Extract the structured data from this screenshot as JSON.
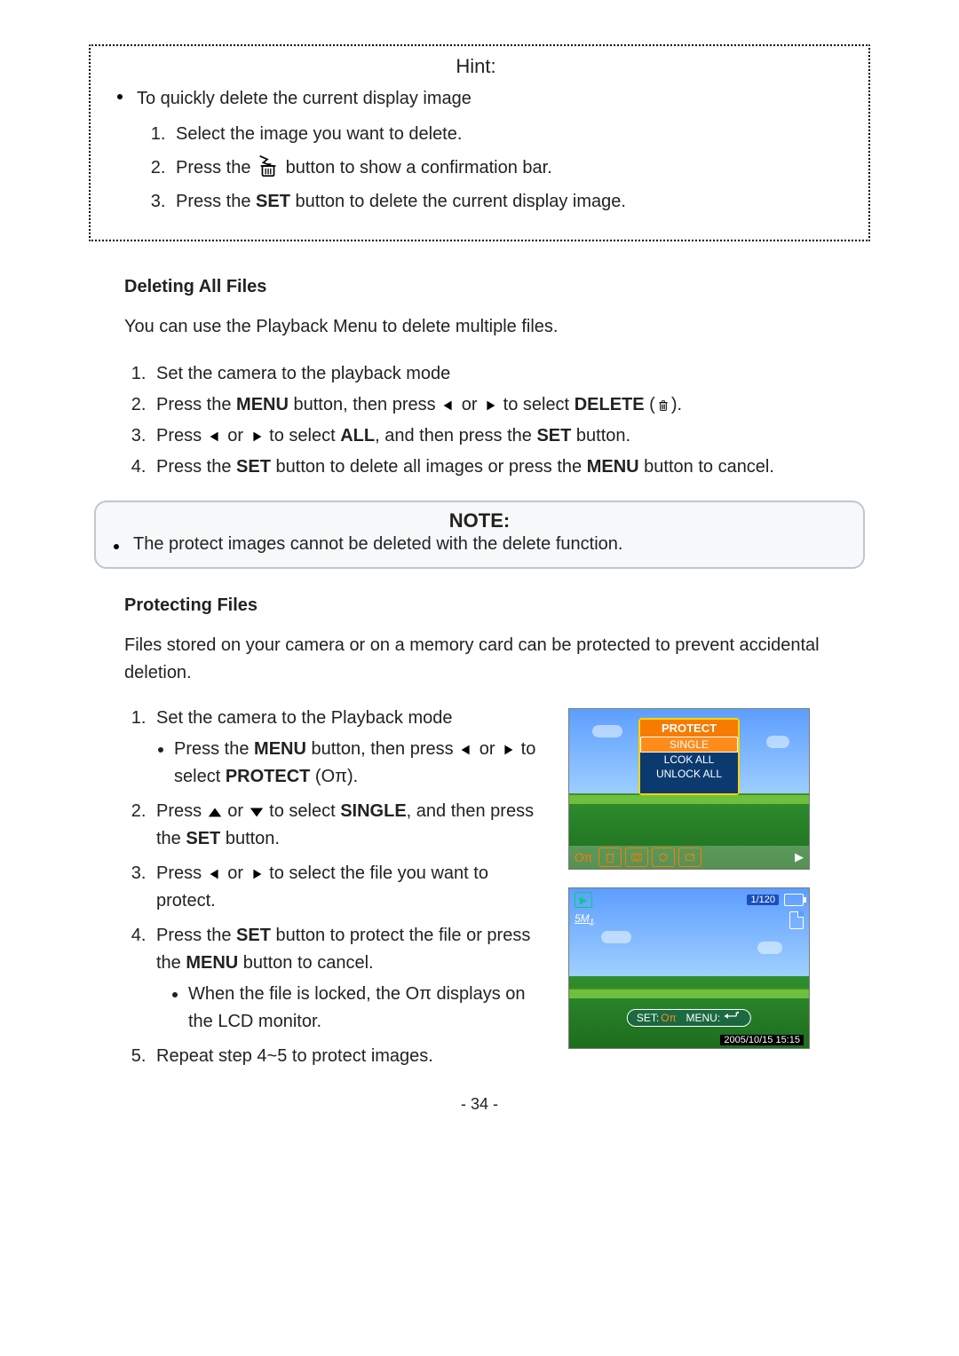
{
  "hint": {
    "title": "Hint:",
    "bullet": "To quickly delete the current display image",
    "steps": [
      "Select the image you want to delete.",
      "Press the ICON_FLASHTRASH button to show a confirmation bar.",
      "Press the SET button to delete the current display image."
    ]
  },
  "section_delete_all": {
    "heading": "Deleting All Files",
    "intro": "You can use the Playback Menu to delete multiple files.",
    "steps": [
      "Set the camera to the playback mode",
      "Press the MENU button, then press  ICON_LEFT  or  ICON_RIGHT  to select DELETE (ICON_TRASH).",
      "Press  ICON_LEFT  or  ICON_RIGHT  to select ALL, and then press the SET button.",
      "Press the SET button to delete all images or press the MENU button to cancel."
    ]
  },
  "note": {
    "title": "NOTE:",
    "text": "The protect images cannot be deleted with the delete function."
  },
  "section_protect": {
    "heading": "Protecting Files",
    "intro": "Files stored on your camera or on a memory card can be protected to prevent accidental deletion.",
    "step1": "Set the camera to the Playback mode",
    "step1_sub": "Press the MENU button, then press  ICON_LEFT  or  ICON_RIGHT to select PROTECT (ICON_KEY).",
    "step2": "Press  ICON_UP  or  ICON_DOWN  to select SINGLE, and then press the SET button.",
    "step3": "Press  ICON_LEFT  or  ICON_RIGHT  to select the file you want to protect.",
    "step4": "Press the SET button to protect the file or press the MENU button to cancel.",
    "step4_sub": "When the file is locked, the  ICON_KEY  displays on the LCD monitor.",
    "step5": "Repeat step 4~5 to protect images."
  },
  "fig1": {
    "title": "PROTECT",
    "selected": "SINGLE",
    "item2": "LCOK ALL",
    "item3": "UNLOCK ALL",
    "on_label": "Oπ"
  },
  "fig2": {
    "counter": "1/120",
    "size": "5M",
    "pill_set": "SET:",
    "pill_on": "Oπ",
    "pill_menu": "MENU:",
    "date": "2005/10/15 15:15"
  },
  "page_number": "- 34 -",
  "icon_key_text": "Oπ",
  "svg": {
    "left": "<svg viewBox='0 0 20 16' class='inl'><polygon points='14,2 4,8 14,14' fill='#000'/></svg>",
    "right": "<svg viewBox='0 0 20 16' class='inl'><polygon points='6,2 16,8 6,14' fill='#000'/></svg>",
    "up": "<svg viewBox='0 0 20 16' class='inl'><polygon points='10,3 18,14 2,14' fill='#000'/></svg>",
    "down": "<svg viewBox='0 0 20 16' class='inl'><polygon points='2,3 18,3 10,14' fill='#000'/></svg>",
    "trash": "<svg viewBox='0 0 24 24' class='inl'><rect x='7' y='7' width='10' height='13' rx='1' fill='none' stroke='#000' stroke-width='1.5'/><line x1='10' y1='10' x2='10' y2='18' stroke='#000' stroke-width='1.2'/><line x1='12' y1='10' x2='12' y2='18' stroke='#000' stroke-width='1.2'/><line x1='14' y1='10' x2='14' y2='18' stroke='#000' stroke-width='1.2'/><line x1='5' y1='7' x2='19' y2='7' stroke='#000' stroke-width='1.5'/><rect x='10' y='4' width='4' height='2.5' fill='none' stroke='#000' stroke-width='1.2'/></svg>",
    "flashtrash": "<svg viewBox='0 0 30 30' class='inl-lg'><polyline points='5,3 14,7 9,11 17,14' fill='none' stroke='#000' stroke-width='1.8'/><polygon points='15,12 19,12 17,16' fill='#000'/><rect x='8' y='15' width='14' height='12' rx='1.5' fill='none' stroke='#000' stroke-width='1.8'/><line x1='12' y1='18' x2='12' y2='25' stroke='#000' stroke-width='1.4'/><line x1='15' y1='18' x2='15' y2='25' stroke='#000' stroke-width='1.4'/><line x1='18' y1='18' x2='18' y2='25' stroke='#000' stroke-width='1.4'/><line x1='6' y1='15' x2='24' y2='15' stroke='#000' stroke-width='1.8'/></svg>"
  }
}
